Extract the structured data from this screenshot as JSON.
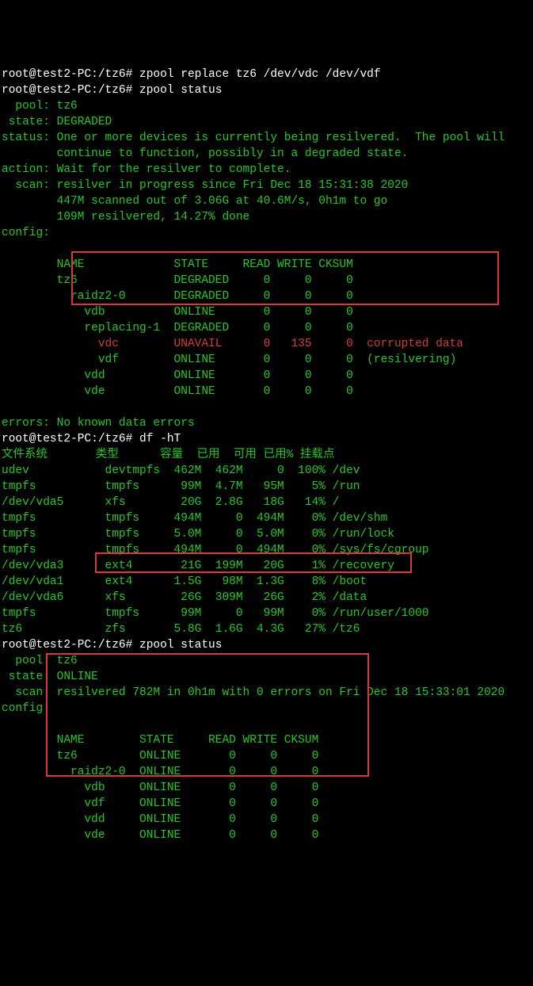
{
  "prompt1": "root@test2-PC:/tz6#",
  "cmd1": "zpool replace tz6 /dev/vdc /dev/vdf",
  "cmd2": "zpool status",
  "status1": {
    "pool": "  pool: tz6",
    "state": " state: DEGRADED",
    "status": "status: One or more devices is currently being resilvered.  The pool will",
    "status2": "        continue to function, possibly in a degraded state.",
    "action": "action: Wait for the resilver to complete.",
    "scan1": "  scan: resilver in progress since Fri Dec 18 15:31:38 2020",
    "scan2": "        447M scanned out of 3.06G at 40.6M/s, 0h1m to go",
    "scan3": "        109M resilvered, 14.27% done",
    "config": "config:",
    "hdr": "        NAME             STATE     READ WRITE CKSUM",
    "r1": "        tz6              DEGRADED     0     0     0",
    "r2": "          raidz2-0       DEGRADED     0     0     0",
    "r3": "            vdb          ONLINE       0     0     0",
    "r4": "            replacing-1  DEGRADED     0     0     0",
    "r5": "              vdc        UNAVAIL      0   135     0  corrupted data",
    "r6": "              vdf        ONLINE       0     0     0  (resilvering)",
    "r7": "            vdd          ONLINE       0     0     0",
    "r8": "            vde          ONLINE       0     0     0",
    "errors": "errors: No known data errors"
  },
  "cmd3": "df -hT",
  "df": {
    "hdr": "文件系统       类型      容量  已用  可用 已用% 挂载点",
    "r1": "udev           devtmpfs  462M  462M     0  100% /dev",
    "r2": "tmpfs          tmpfs      99M  4.7M   95M    5% /run",
    "r3": "/dev/vda5      xfs        20G  2.8G   18G   14% /",
    "r4": "tmpfs          tmpfs     494M     0  494M    0% /dev/shm",
    "r5": "tmpfs          tmpfs     5.0M     0  5.0M    0% /run/lock",
    "r6": "tmpfs          tmpfs     494M     0  494M    0% /sys/fs/cgroup",
    "r7": "/dev/vda3      ext4       21G  199M   20G    1% /recovery",
    "r8": "/dev/vda1      ext4      1.5G   98M  1.3G    8% /boot",
    "r9": "/dev/vda6      xfs        26G  309M   26G    2% /data",
    "r10": "tmpfs          tmpfs      99M     0   99M    0% /run/user/1000",
    "r11": "tz6            zfs       5.8G  1.6G  4.3G   27% /tz6"
  },
  "cmd4": "zpool status",
  "status2b": {
    "pool": "  pool: tz6",
    "state": " state: ONLINE",
    "scan": "  scan: resilvered 782M in 0h1m with 0 errors on Fri Dec 18 15:33:01 2020",
    "config": "config:",
    "hdr": "        NAME        STATE     READ WRITE CKSUM",
    "r1": "        tz6         ONLINE       0     0     0",
    "r2": "          raidz2-0  ONLINE       0     0     0",
    "r3": "            vdb     ONLINE       0     0     0",
    "r4": "            vdf     ONLINE       0     0     0",
    "r5": "            vdd     ONLINE       0     0     0",
    "r6": "            vde     ONLINE       0     0     0"
  }
}
